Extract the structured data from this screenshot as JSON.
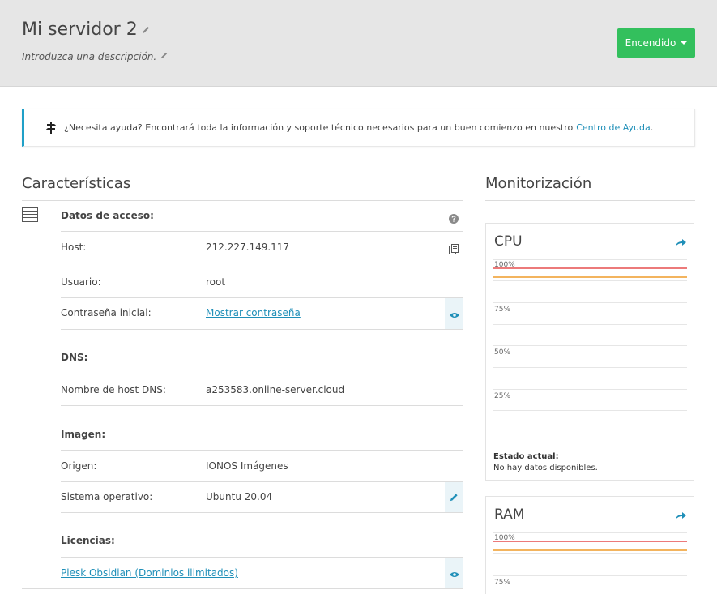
{
  "header": {
    "title": "Mi servidor 2",
    "description": "Introduzca una descripción.",
    "power_label": "Encendido"
  },
  "help": {
    "text": "¿Necesita ayuda? Encontrará toda la información y soporte técnico necesarios para un buen comienzo en nuestro",
    "link": "Centro de Ayuda",
    "suffix": "."
  },
  "features": {
    "title": "Características",
    "access": {
      "heading": "Datos de acceso:",
      "host_label": "Host:",
      "host_value": "212.227.149.117",
      "user_label": "Usuario:",
      "user_value": "root",
      "password_label": "Contraseña inicial:",
      "password_link": "Mostrar contraseña"
    },
    "dns": {
      "heading": "DNS:",
      "hostname_label": "Nombre de host DNS:",
      "hostname_value": "a253583.online-server.cloud"
    },
    "image": {
      "heading": "Imagen:",
      "origin_label": "Origen:",
      "origin_value": "IONOS Imágenes",
      "os_label": "Sistema operativo:",
      "os_value": "Ubuntu 20.04"
    },
    "licenses": {
      "heading": "Licencias:",
      "item": "Plesk Obsidian (Dominios ilimitados)"
    }
  },
  "monitoring": {
    "title": "Monitorización",
    "cpu": {
      "title": "CPU",
      "labels": [
        "100%",
        "75%",
        "50%",
        "25%"
      ],
      "state_label": "Estado actual:",
      "state_value": "No hay datos disponibles."
    },
    "ram": {
      "title": "RAM",
      "labels": [
        "100%",
        "75%"
      ]
    }
  },
  "colors": {
    "accent": "#1f8fb8",
    "power": "#33c05d",
    "limit_red": "#ec7a7a",
    "limit_orange": "#f3b45e"
  }
}
